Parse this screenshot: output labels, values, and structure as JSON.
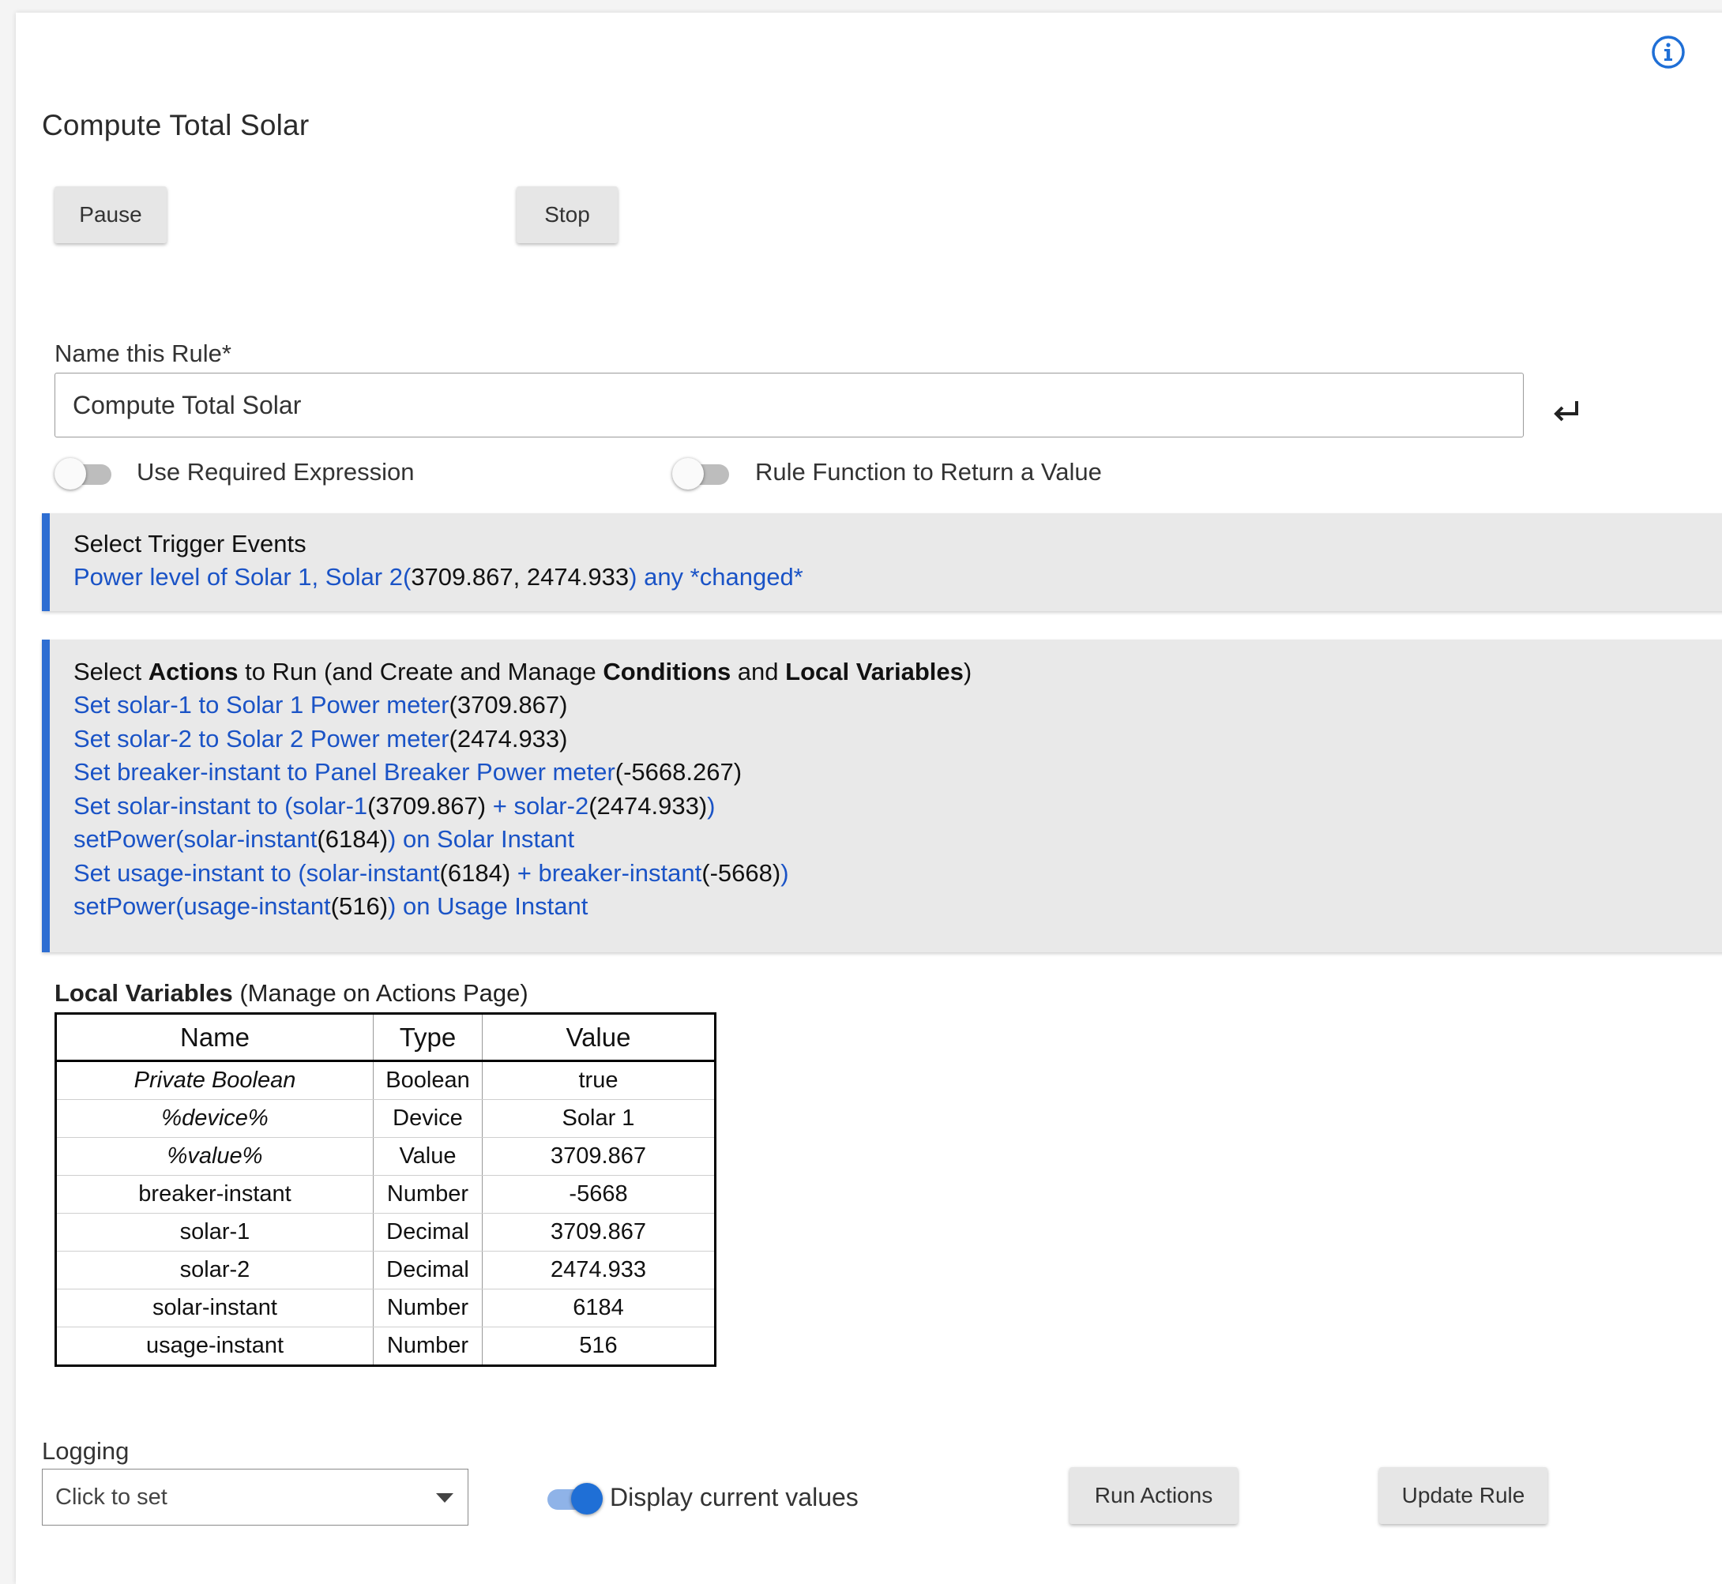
{
  "rule": {
    "title": "Compute Total Solar",
    "pause_label": "Pause",
    "stop_label": "Stop",
    "name_label": "Name this Rule*",
    "name_value": "Compute Total Solar"
  },
  "toggles": {
    "required_expression": {
      "label": "Use Required Expression",
      "on": false
    },
    "rule_function": {
      "label": "Rule Function to Return a Value",
      "on": false
    },
    "display_values": {
      "label": "Display current values",
      "on": true
    }
  },
  "triggers": {
    "heading": "Select Trigger Events",
    "line_a": "Power level of Solar 1, Solar 2(",
    "line_b": "3709.867, 2474.933",
    "line_c": ") any *changed*"
  },
  "actions": {
    "h1": "Select ",
    "h2": "Actions",
    "h3": " to Run (and Create and Manage ",
    "h4": "Conditions",
    "h5": " and ",
    "h6": "Local Variables",
    "h7": ")",
    "items": [
      {
        "a": "Set solar-1 to Solar 1 Power meter",
        "b": "(3709.867)"
      },
      {
        "a": "Set solar-2 to Solar 2 Power meter",
        "b": "(2474.933)"
      },
      {
        "a": "Set breaker-instant to Panel Breaker Power meter",
        "b": "(-5668.267)"
      },
      {
        "a": "Set solar-instant to (solar-1",
        "b": "(3709.867)",
        "c": " + solar-2",
        "d": "(2474.933)",
        "e": ")"
      },
      {
        "a": "setPower(solar-instant",
        "b": "(6184)",
        "c": ") on Solar Instant"
      },
      {
        "a": "Set usage-instant to (solar-instant",
        "b": "(6184)",
        "c": " + breaker-instant",
        "d": "(-5668)",
        "e": ")"
      },
      {
        "a": "setPower(usage-instant",
        "b": "(516)",
        "c": ") on Usage Instant"
      }
    ]
  },
  "local_variables": {
    "title_bold": "Local Variables",
    "title_rest": " (Manage on Actions Page)",
    "columns": [
      "Name",
      "Type",
      "Value"
    ],
    "rows": [
      [
        "Private Boolean",
        "Boolean",
        "true"
      ],
      [
        "%device%",
        "Device",
        "Solar 1"
      ],
      [
        "%value%",
        "Value",
        "3709.867"
      ],
      [
        "breaker-instant",
        "Number",
        "-5668"
      ],
      [
        "solar-1",
        "Decimal",
        "3709.867"
      ],
      [
        "solar-2",
        "Decimal",
        "2474.933"
      ],
      [
        "solar-instant",
        "Number",
        "6184"
      ],
      [
        "usage-instant",
        "Number",
        "516"
      ]
    ]
  },
  "logging": {
    "label": "Logging",
    "select_value": "Click to set"
  },
  "buttons": {
    "run_actions": "Run Actions",
    "update_rule": "Update Rule"
  },
  "icons": {
    "info": "info-icon",
    "expand": "expand-icon",
    "enter": "enter-arrow-icon",
    "caret": "caret-down-icon"
  },
  "colors": {
    "accent_blue": "#1a53c6",
    "section_border": "#2e6ed2",
    "section_bg": "#e9e9e9"
  }
}
